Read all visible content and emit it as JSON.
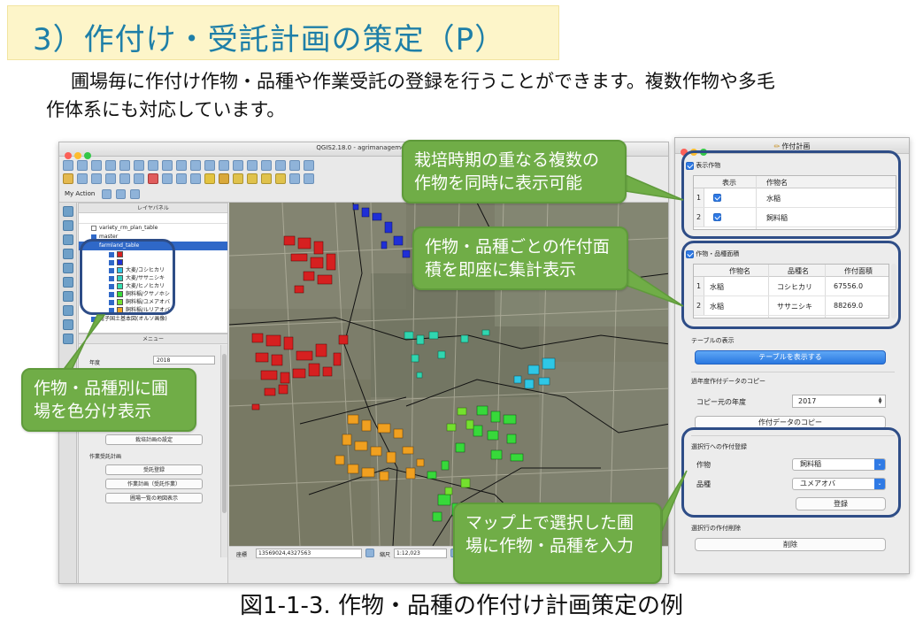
{
  "title": "3）作付け・受託計画の策定（P）",
  "intro": {
    "line1": "圃場毎に作付け作物・品種や作業受託の登録を行うことができます。複数作物や多毛",
    "line2": "作体系にも対応しています。"
  },
  "caption": "図1-1-3. 作物・品種の作付け計画策定の例",
  "callouts": {
    "overlap": "栽培時期の重なる複数の作物を同時に表示可能",
    "area": "作物・品種ごとの作付面積を即座に集計表示",
    "color": "作物・品種別に圃場を色分け表示",
    "select": "マップ上で選択した圃場に作物・品種を入力"
  },
  "qgis": {
    "window_title": "QGIS2.18.0 - agrimanagement",
    "tab_label": "My Action",
    "layer_panel_title": "レイヤパネル",
    "layers": [
      {
        "name": "variety_rm_plan_table",
        "checked": false,
        "selected": false
      },
      {
        "name": "master",
        "checked": true,
        "selected": false
      },
      {
        "name": "farmland_table",
        "checked": true,
        "selected": true
      }
    ],
    "legend": [
      {
        "label": "",
        "color": "#d62020"
      },
      {
        "label": "",
        "color": "#1f2fd6"
      },
      {
        "label": "大麦/コシヒカリ",
        "color": "#2ec7e6"
      },
      {
        "label": "大麦/ササニシキ",
        "color": "#30d0c0"
      },
      {
        "label": "大麦/ヒノヒカリ",
        "color": "#34e0b0"
      },
      {
        "label": "飼料稲/クサノホシ",
        "color": "#37d93a"
      },
      {
        "label": "飼料稲/ユメアオバ",
        "color": "#74e02e"
      },
      {
        "label": "飼料稲/ルリアオバ",
        "color": "#f0a020"
      }
    ],
    "base_layer": "電子国土基本図(オルソ画像)",
    "menu_panel_title": "メニュー",
    "menu": {
      "year_label": "年度",
      "year_value": "2018",
      "btn_plan": "栽培計画の設定",
      "section_label": "作業受託計画",
      "btn_register": "受託登録",
      "btn_list": "作業計画（受託作業）",
      "btn_view": "圃場一覧の地図表示"
    },
    "status": {
      "coord_label": "座標",
      "coord_value": "13569024,4327563",
      "scale_label": "縮尺",
      "scale_value": "1:12,023"
    }
  },
  "dialog": {
    "title": "作付計画",
    "crop_section_label": "表示作物",
    "crop_table": {
      "headers": [
        "表示",
        "作物名"
      ],
      "rows": [
        {
          "num": "1",
          "checked": true,
          "crop": "水稲"
        },
        {
          "num": "2",
          "checked": true,
          "crop": "飼料稲"
        }
      ]
    },
    "area_section_label": "作物・品種面積",
    "area_table": {
      "headers": [
        "作物名",
        "品種名",
        "作付面積"
      ],
      "rows": [
        {
          "num": "1",
          "crop": "水稲",
          "variety": "コシヒカリ",
          "area": "67556.0"
        },
        {
          "num": "2",
          "crop": "水稲",
          "variety": "ササニシキ",
          "area": "88269.0"
        }
      ]
    },
    "table_display_label": "テーブルの表示",
    "show_table_button": "テーブルを表示する",
    "copy_section_label": "過年度作付データのコピー",
    "copy_year_label": "コピー元の年度",
    "copy_year_value": "2017",
    "copy_button": "作付データのコピー",
    "register_section_label": "選択行への作付登録",
    "crop_label": "作物",
    "crop_value": "飼料稲",
    "variety_label": "品種",
    "variety_value": "ユメアオバ",
    "register_button": "登録",
    "delete_section_label": "選択行の作付削除",
    "delete_button": "削除"
  },
  "colors": {
    "title_text": "#1e7fa8",
    "title_bg": "#fdf5c9",
    "callout_green": "#70ad47",
    "highlight_border": "#2e4d87",
    "rice_red": "#d62020",
    "blue": "#1f2fd6",
    "cyan": "#2ec7e6",
    "green": "#37d93a",
    "lime": "#74e02e",
    "orange": "#f0a020"
  }
}
